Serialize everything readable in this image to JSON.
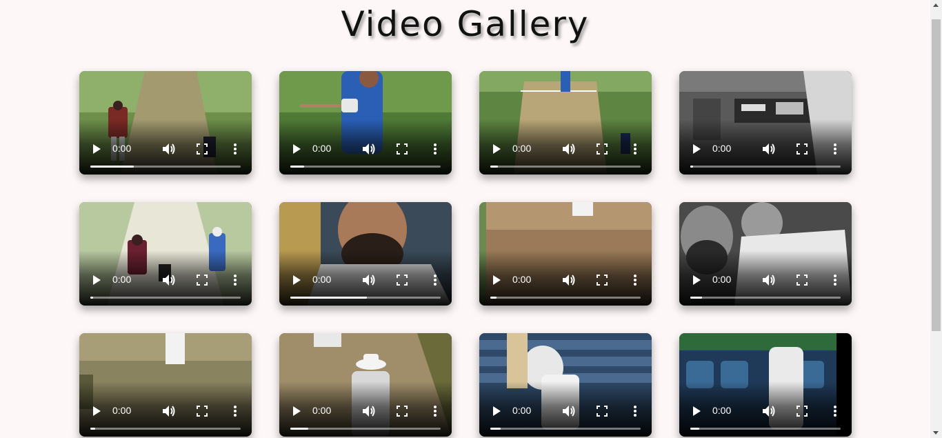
{
  "header": {
    "title": "Video Gallery"
  },
  "colors": {
    "background": "#fdf7f7",
    "controls": "#ffffff"
  },
  "videos": [
    {
      "time": "0:00",
      "progress": 0.29,
      "scene": "pitch-batsman"
    },
    {
      "time": "0:00",
      "progress": 0.09,
      "scene": "blue-batsman"
    },
    {
      "time": "0:00",
      "progress": 0.05,
      "scene": "pitch-wide"
    },
    {
      "time": "0:00",
      "progress": 0.02,
      "scene": "mono-board"
    },
    {
      "time": "0:00",
      "progress": 0.02,
      "scene": "pitch-bright"
    },
    {
      "time": "0:00",
      "progress": 0.51,
      "scene": "closeup-face"
    },
    {
      "time": "0:00",
      "progress": 0.04,
      "scene": "brown-pitch"
    },
    {
      "time": "0:00",
      "progress": 0.08,
      "scene": "mono-celebrate"
    },
    {
      "time": "0:00",
      "progress": 0.03,
      "scene": "pale-pitch"
    },
    {
      "time": "0:00",
      "progress": 0.12,
      "scene": "umpire"
    },
    {
      "time": "0:00",
      "progress": 0.07,
      "scene": "stands-batsman"
    },
    {
      "time": "0:00",
      "progress": 0.06,
      "scene": "stands-green"
    }
  ],
  "icons": {
    "play": "play-icon",
    "volume": "volume-icon",
    "fullscreen": "fullscreen-icon",
    "more": "more-vertical-icon"
  }
}
